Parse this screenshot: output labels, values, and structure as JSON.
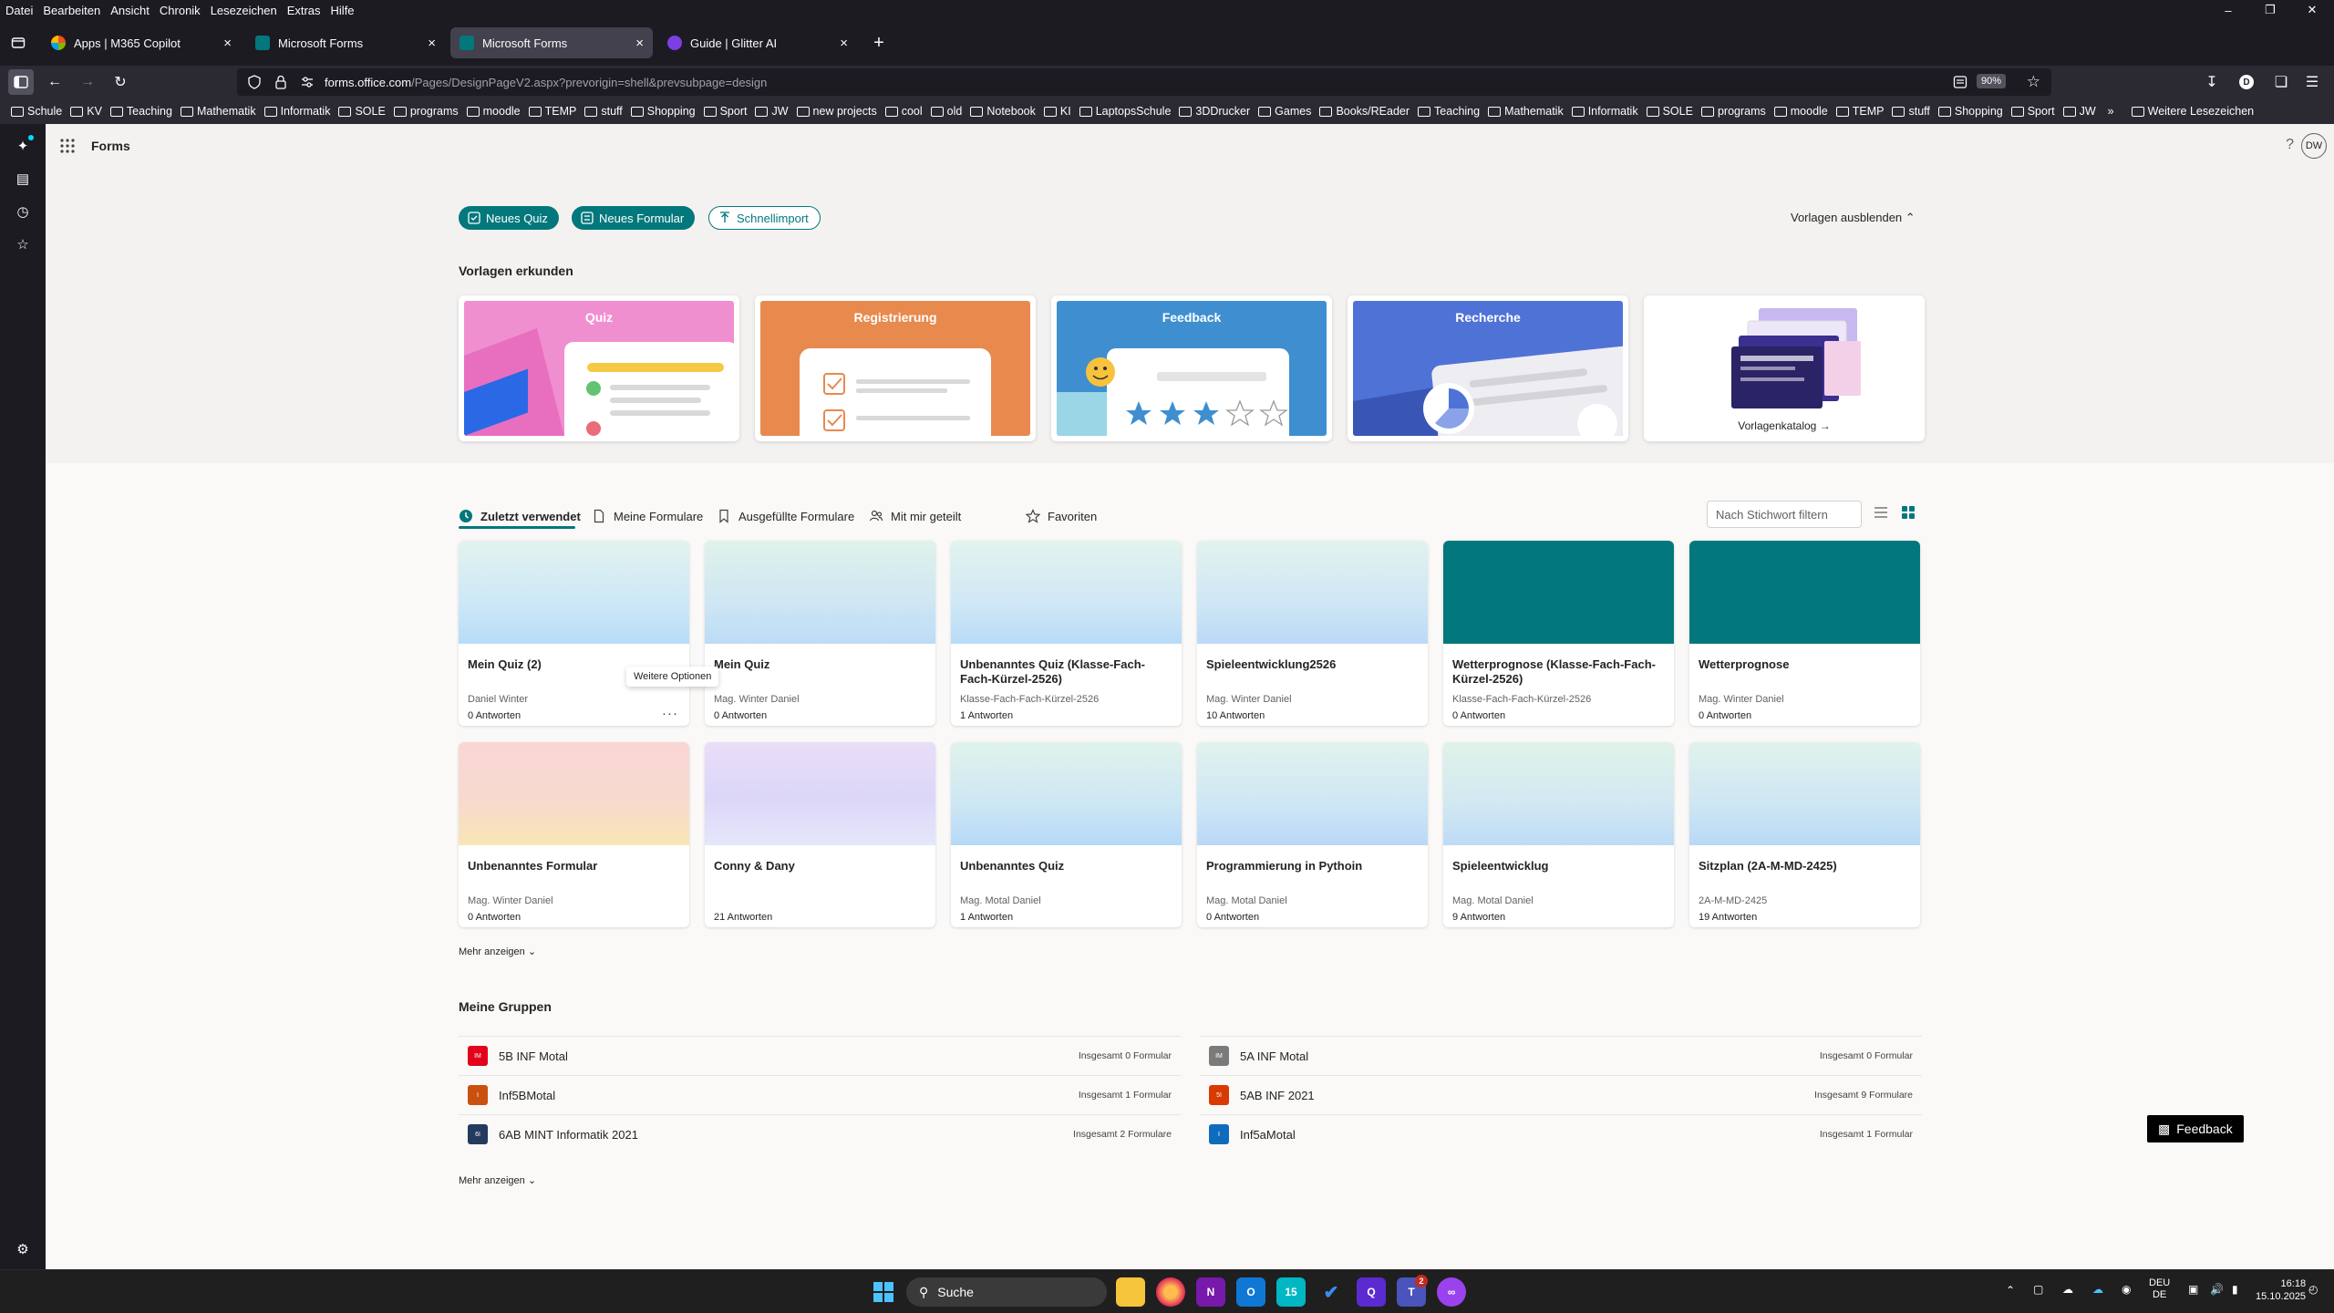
{
  "menubar": {
    "items": [
      "Datei",
      "Bearbeiten",
      "Ansicht",
      "Chronik",
      "Lesezeichen",
      "Extras",
      "Hilfe"
    ]
  },
  "browser_tabs": [
    {
      "title": "Apps | M365 Copilot",
      "active": false
    },
    {
      "title": "Microsoft Forms",
      "active": false
    },
    {
      "title": "Microsoft Forms",
      "active": true
    },
    {
      "title": "Guide | Glitter AI",
      "active": false
    }
  ],
  "nav": {
    "url_domain": "forms.office.com",
    "url_path": "/Pages/DesignPageV2.aspx?prevorigin=shell&prevsubpage=design",
    "zoom": "90%"
  },
  "bookmarks": [
    "Schule",
    "KV",
    "Teaching",
    "Mathematik",
    "Informatik",
    "SOLE",
    "programs",
    "moodle",
    "TEMP",
    "stuff",
    "Shopping",
    "Sport",
    "JW",
    "new projects",
    "cool",
    "old",
    "Notebook",
    "KI",
    "LaptopsSchule",
    "3DDrucker",
    "Games",
    "Books/REader",
    "Teaching",
    "Mathematik",
    "Informatik",
    "SOLE",
    "programs",
    "moodle",
    "TEMP",
    "stuff",
    "Shopping",
    "Sport",
    "JW"
  ],
  "bookmarks_more": "Weitere Lesezeichen",
  "app": {
    "name": "Forms",
    "help": "?",
    "avatar": "DW"
  },
  "actions": {
    "new_quiz": "Neues Quiz",
    "new_form": "Neues Formular",
    "quick_import": "Schnellimport",
    "hide_templates": "Vorlagen ausblenden"
  },
  "templates": {
    "heading": "Vorlagen erkunden",
    "items": [
      "Quiz",
      "Registrierung",
      "Feedback",
      "Recherche"
    ],
    "catalog": "Vorlagenkatalog"
  },
  "tabs": [
    "Zuletzt verwendet",
    "Meine Formulare",
    "Ausgefüllte Formulare",
    "Mit mir geteilt",
    "Favoriten"
  ],
  "filter": {
    "placeholder": "Nach Stichwort filtern"
  },
  "forms": [
    {
      "title": "Mein Quiz (2)",
      "owner": "Daniel Winter",
      "answers": "0 Antworten"
    },
    {
      "title": "Mein Quiz",
      "owner": "Mag. Winter Daniel",
      "answers": "0 Antworten"
    },
    {
      "title": "Unbenanntes Quiz (Klasse-Fach-Fach-Kürzel-2526)",
      "owner": "Klasse-Fach-Fach-Kürzel-2526",
      "answers": "1 Antworten"
    },
    {
      "title": "Spieleentwicklung2526",
      "owner": "Mag. Winter Daniel",
      "answers": "10 Antworten"
    },
    {
      "title": "Wetterprognose (Klasse-Fach-Fach-Kürzel-2526)",
      "owner": "Klasse-Fach-Fach-Kürzel-2526",
      "answers": "0 Antworten"
    },
    {
      "title": "Wetterprognose",
      "owner": "Mag. Winter Daniel",
      "answers": "0 Antworten"
    },
    {
      "title": "Unbenanntes Formular",
      "owner": "Mag. Winter Daniel",
      "answers": "0 Antworten"
    },
    {
      "title": "Conny & Dany",
      "owner": "",
      "answers": "21 Antworten"
    },
    {
      "title": "Unbenanntes Quiz",
      "owner": "Mag. Motal Daniel",
      "answers": "1 Antworten"
    },
    {
      "title": "Programmierung in Pythoin",
      "owner": "Mag. Motal Daniel",
      "answers": "0 Antworten"
    },
    {
      "title": "Spieleentwicklug",
      "owner": "Mag. Motal Daniel",
      "answers": "9 Antworten"
    },
    {
      "title": "Sitzplan (2A-M-MD-2425)",
      "owner": "2A-M-MD-2425",
      "answers": "19 Antworten"
    }
  ],
  "tooltip": "Weitere Optionen",
  "more": "Mehr anzeigen",
  "groups": {
    "heading": "Meine Gruppen",
    "items": [
      {
        "abbr": "IM",
        "name": "5B INF Motal",
        "count": "Insgesamt 0 Formular",
        "color": "#e3001b"
      },
      {
        "abbr": "IM",
        "name": "5A INF Motal",
        "count": "Insgesamt 0 Formular",
        "color": "#7a7a7a"
      },
      {
        "abbr": "I",
        "name": "Inf5BMotal",
        "count": "Insgesamt 1 Formular",
        "color": "#ca5010"
      },
      {
        "abbr": "5I",
        "name": "5AB INF 2021",
        "count": "Insgesamt 9 Formulare",
        "color": "#d83b01"
      },
      {
        "abbr": "6I",
        "name": "6AB MINT Informatik 2021",
        "count": "Insgesamt 2 Formulare",
        "color": "#243a5e"
      },
      {
        "abbr": "I",
        "name": "Inf5aMotal",
        "count": "Insgesamt 1 Formular",
        "color": "#0f6cbd"
      }
    ]
  },
  "feedback": "Feedback",
  "taskbar": {
    "search": "Suche",
    "lang1": "DEU",
    "lang2": "DE",
    "time": "16:18",
    "date": "15.10.2025",
    "badge": "2"
  }
}
